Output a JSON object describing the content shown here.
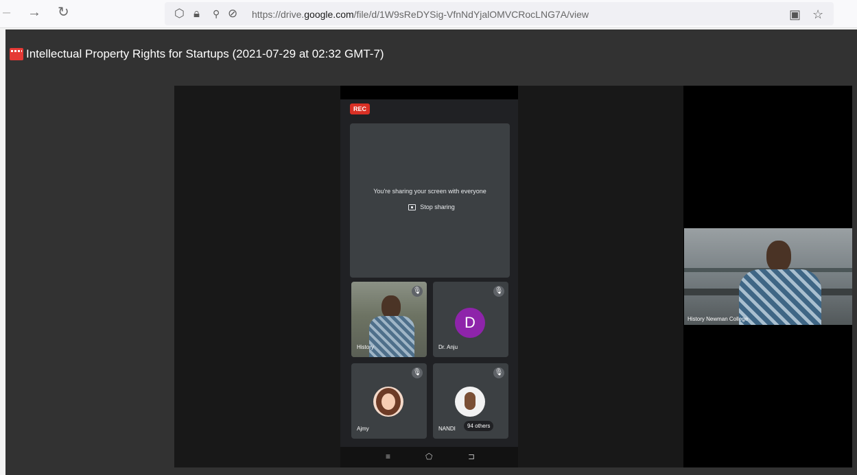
{
  "browser": {
    "url_prefix": "https://drive.",
    "url_domain": "google.com",
    "url_suffix": "/file/d/1W9sReDYSig-VfnNdYjalOMVCRocLNG7A/view"
  },
  "viewer": {
    "file_title": "Intellectual Property Rights for Startups (2021-07-29 at 02:32 GMT-7)"
  },
  "meet": {
    "rec_label": "REC",
    "share_message": "You're sharing your screen with everyone",
    "stop_sharing_label": "Stop sharing",
    "tiles": [
      {
        "name": "History"
      },
      {
        "name": "Dr. Anju",
        "initial": "D"
      },
      {
        "name": "Ajmy"
      },
      {
        "name": "NANDI",
        "others_badge": "94 others"
      }
    ],
    "speaker_label": "History Newman College"
  },
  "colors": {
    "rec_red": "#d93025",
    "avatar_purple": "#8e24aa",
    "viewer_bg": "#323232"
  }
}
